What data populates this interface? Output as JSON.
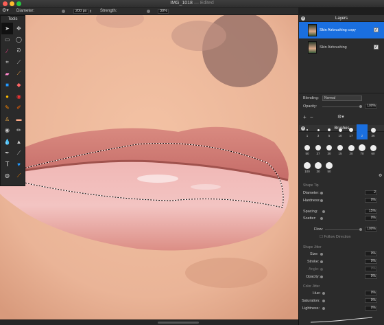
{
  "window": {
    "title": "IMG_1018",
    "status": "Edited"
  },
  "options": {
    "diameter_label": "Diameter:",
    "diameter_value": "200 px",
    "strength_label": "Strength:",
    "strength_value": "30%"
  },
  "tools": {
    "title": "Tools"
  },
  "layers": {
    "title": "Layers",
    "items": [
      {
        "name": "Skin Airbrushing copy",
        "checked": "✓"
      },
      {
        "name": "Skin Airbrushing",
        "checked": "✓"
      }
    ],
    "blending_label": "Blending:",
    "blending_value": "Normal",
    "opacity_label": "Opacity:",
    "opacity_value": "100%",
    "add": "+",
    "remove": "−"
  },
  "brushes": {
    "title": "Brushes",
    "row1": [
      "1",
      "3",
      "5",
      "10",
      "17",
      "2",
      "36"
    ],
    "row2": [
      "50",
      "37",
      "30",
      "15",
      "20",
      "70",
      "60"
    ],
    "row3": [
      "100",
      "30",
      "50"
    ]
  },
  "shape_tip": {
    "title": "Shape Tip",
    "diameter_label": "Diameter:",
    "diameter_value": "2",
    "hardness_label": "Hardness:",
    "hardness_value": "0%",
    "spacing_label": "Spacing:",
    "spacing_value": "15%",
    "scatter_label": "Scatter:",
    "scatter_value": "0%",
    "flow_label": "Flow:",
    "flow_value": "100%",
    "follow_label": "Follow Direction"
  },
  "shape_jitter": {
    "title": "Shape Jitter",
    "size_label": "Size:",
    "size_value": "0%",
    "stroke_label": "Stroke:",
    "stroke_value": "0%",
    "angle_label": "Angle:",
    "angle_value": "0%",
    "opacity_label": "Opacity:",
    "opacity_value": "0%"
  },
  "color_jitter": {
    "title": "Color Jitter",
    "hue_label": "Hue:",
    "hue_value": "0%",
    "saturation_label": "Saturation:",
    "saturation_value": "0%",
    "lightness_label": "Lightness:",
    "lightness_value": "0%"
  },
  "colors": {
    "accent": "#1a6fe0",
    "selection": "#1a6fe0"
  }
}
